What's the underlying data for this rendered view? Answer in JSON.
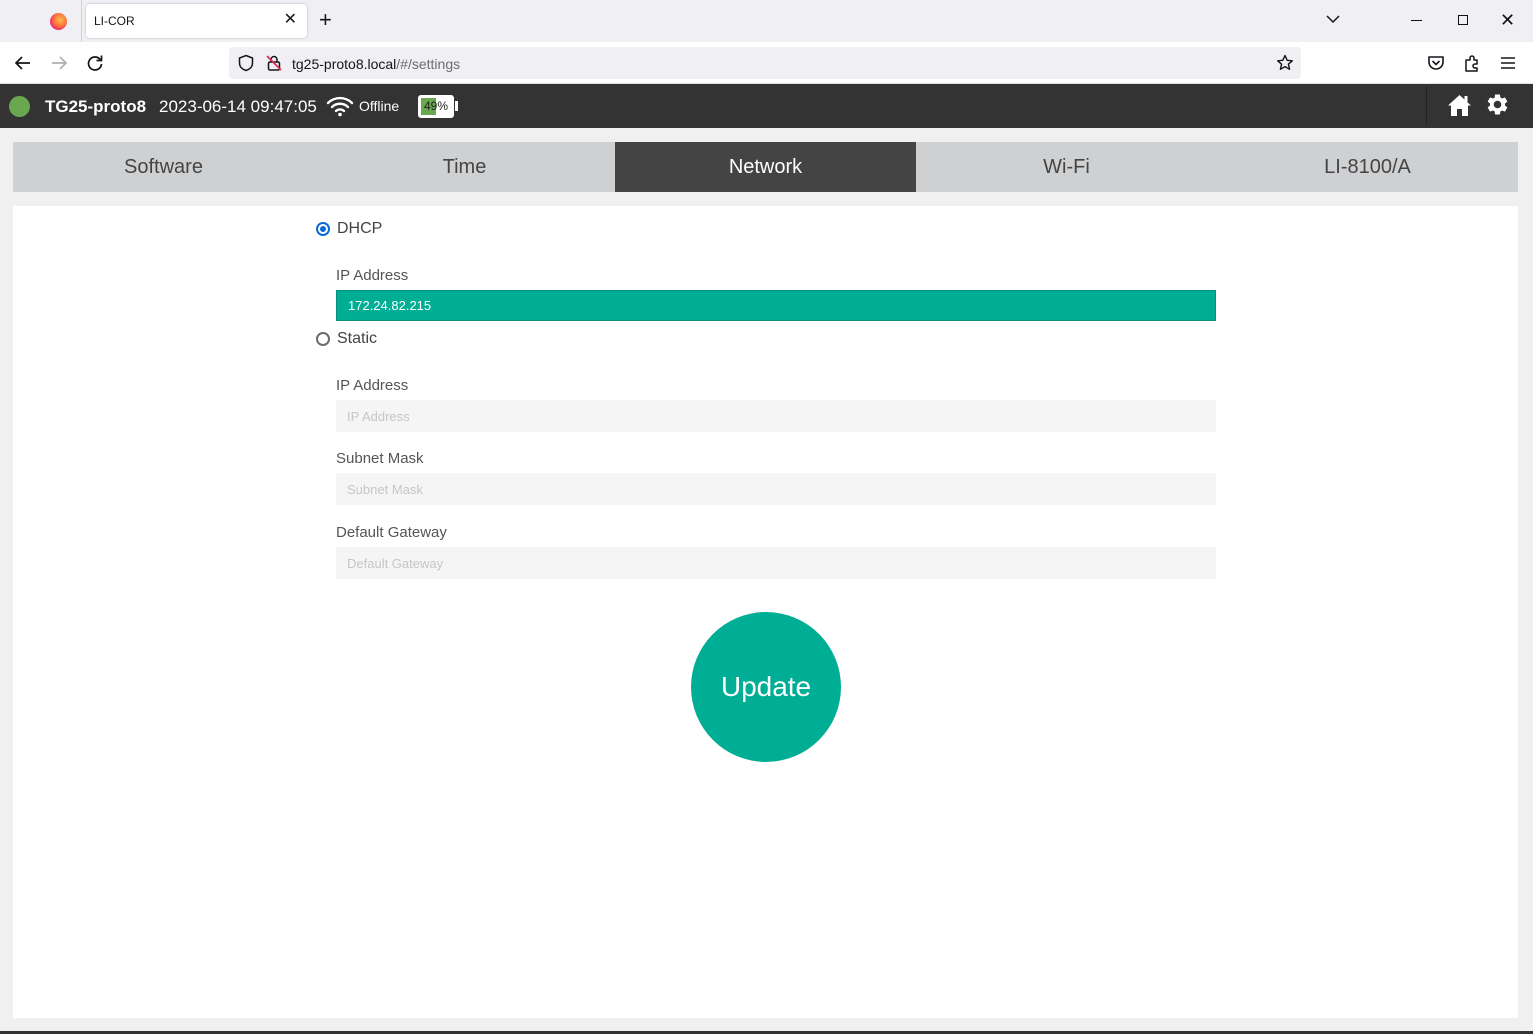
{
  "browser": {
    "tab_title": "LI-COR",
    "tab_close": "✕",
    "new_tab": "+",
    "url_host": "tg25-proto8.local",
    "url_path": "/#/settings",
    "window_close": "✕"
  },
  "header": {
    "device_name": "TG25-proto8",
    "datetime": "2023-06-14 09:47:05",
    "connection": "Offline",
    "battery_text": "49%",
    "battery_level": 49,
    "status_color": "#6aa84f"
  },
  "tabs": [
    {
      "label": "Software",
      "active": false
    },
    {
      "label": "Time",
      "active": false
    },
    {
      "label": "Network",
      "active": true
    },
    {
      "label": "Wi-Fi",
      "active": false
    },
    {
      "label": "LI-8100/A",
      "active": false
    }
  ],
  "network": {
    "dhcp": {
      "label": "DHCP",
      "selected": true,
      "ip_label": "IP Address",
      "ip_value": "172.24.82.215"
    },
    "static": {
      "label": "Static",
      "selected": false,
      "ip_label": "IP Address",
      "ip_placeholder": "IP Address",
      "subnet_label": "Subnet Mask",
      "subnet_placeholder": "Subnet Mask",
      "gateway_label": "Default Gateway",
      "gateway_placeholder": "Default Gateway"
    },
    "update_label": "Update"
  },
  "colors": {
    "accent": "#00ae96",
    "header_bg": "#333333",
    "active_tab": "#444444"
  }
}
